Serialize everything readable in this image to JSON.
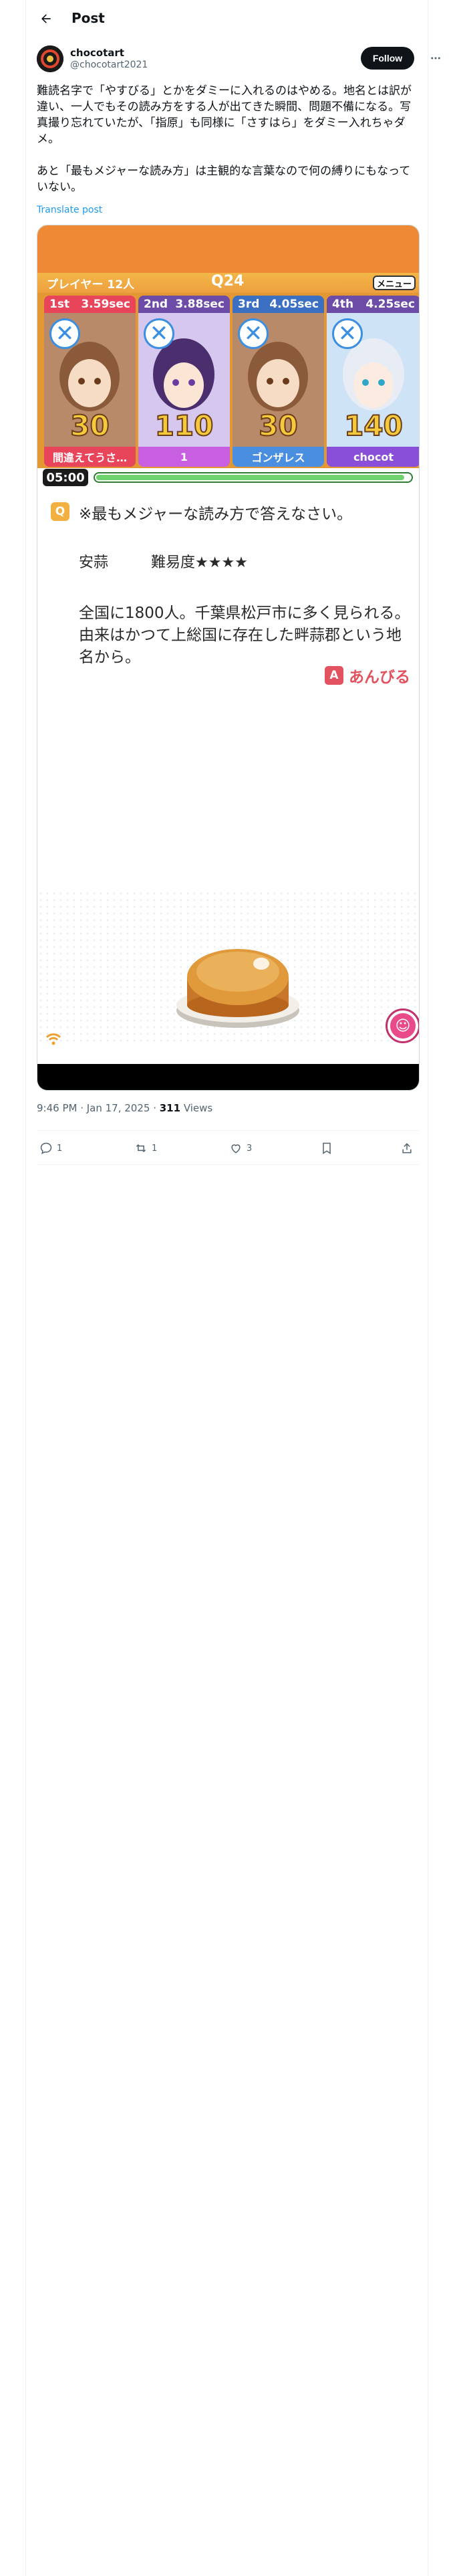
{
  "header": {
    "title": "Post"
  },
  "author": {
    "display_name": "chocotart",
    "handle": "@chocotart2021",
    "follow_label": "Follow"
  },
  "post": {
    "text": "難読名字で「やすびる」とかをダミーに入れるのはやめる。地名とは訳が違い、一人でもその読み方をする人が出てきた瞬間、問題不備になる。写真撮り忘れていたが、「指原」も同様に「さすはら」をダミー入れちゃダメ。\n\nあと「最もメジャーな読み方」は主観的な言葉なので何の縛りにもなっていない。",
    "translate_label": "Translate post",
    "timestamp": "9:46 PM · Jan 17, 2025 · ",
    "views_count": "311",
    "views_label": " Views"
  },
  "actions": {
    "replies": "1",
    "reposts": "1",
    "likes": "3"
  },
  "game": {
    "players_label": "プレイヤー 12人",
    "round_label": "Q24",
    "menu_label": "メニュー",
    "players": [
      {
        "rank": "1st",
        "time": "3.59sec",
        "score": "30",
        "name": "間違えてうさ…",
        "rank_color": "#e8445a",
        "name_color": "#e8445a"
      },
      {
        "rank": "2nd",
        "time": "3.88sec",
        "score": "110",
        "name": "1",
        "rank_color": "#6d4ca8",
        "name_color": "#c85fe0"
      },
      {
        "rank": "3rd",
        "time": "4.05sec",
        "score": "30",
        "name": "ゴンザレス",
        "rank_color": "#3a6fc2",
        "name_color": "#4a8ee0"
      },
      {
        "rank": "4th",
        "time": "4.25sec",
        "score": "140",
        "name": "chocot",
        "rank_color": "#6d4ca8",
        "name_color": "#8a4fd8"
      }
    ],
    "timer": "05:00",
    "timer_fraction": 0.98,
    "question_badge": "Q",
    "question": "※最もメジャーな読み方で答えなさい。",
    "word": "安蒜",
    "difficulty": "難易度★★★★",
    "answer_text": "全国に1800人。千葉県松戸市に多く見られる。由来はかつて上総国に存在した畔蒜郡という地名から。",
    "answer_badge": "A",
    "answer_reading": "あんびる"
  }
}
